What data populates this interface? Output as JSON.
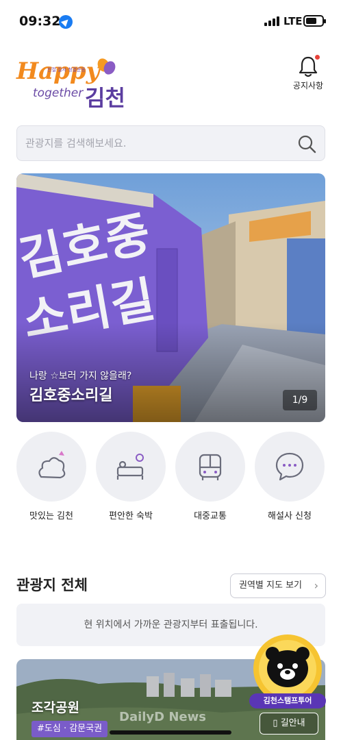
{
  "status_bar": {
    "time": "09:32",
    "network": "LTE"
  },
  "header": {
    "logo_text": "Happy",
    "logo_tagline": "친절·질서·청결운동",
    "logo_together": "together",
    "logo_city": "김천",
    "notice_label": "공지사항"
  },
  "search": {
    "placeholder": "관광지를 검색해보세요."
  },
  "hero": {
    "subtitle": "나랑 ☆보러 가지 않을래?",
    "title": "김호중소리길",
    "mural_text": "김호중 소리길",
    "counter": "1/9"
  },
  "quick_menu": [
    {
      "label": "맛있는 김천",
      "icon": "food-icon"
    },
    {
      "label": "편안한 숙박",
      "icon": "bed-icon"
    },
    {
      "label": "대중교통",
      "icon": "bus-icon"
    },
    {
      "label": "해설사 신청",
      "icon": "chat-icon"
    }
  ],
  "section": {
    "title": "관광지 전체",
    "map_button": "권역별 지도 보기",
    "info": "현 위치에서 가까운 관광지부터 표출됩니다."
  },
  "card": {
    "name": "조각공원",
    "tag": "#도심 · 감문국권",
    "guide_button": "길안내",
    "watermark": "DailyD News"
  },
  "stamp_badge": {
    "label": "김천스탬프투어"
  },
  "colors": {
    "brand_purple": "#6a4aa5",
    "brand_orange": "#f28a1e",
    "alert_red": "#e8433b"
  }
}
